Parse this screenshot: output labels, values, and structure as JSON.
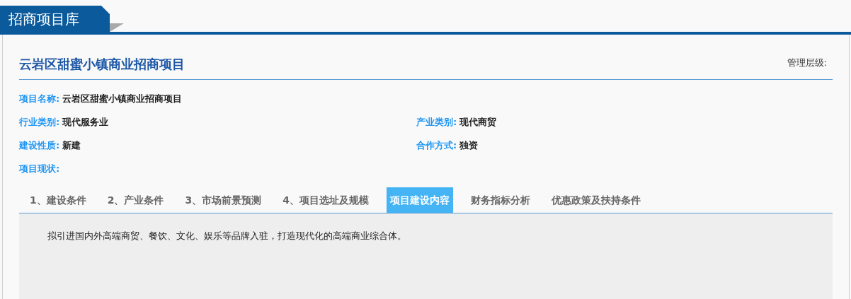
{
  "header": {
    "title": "招商项目库"
  },
  "project": {
    "title": "云岩区甜蜜小镇商业招商项目",
    "management_level": "管理层级:"
  },
  "field_rows": [
    [
      {
        "label": "项目名称:",
        "value": "云岩区甜蜜小镇商业招商项目"
      }
    ],
    [
      {
        "label": "行业类别:",
        "value": "现代服务业"
      },
      {
        "label": "产业类别:",
        "value": "现代商贸"
      }
    ],
    [
      {
        "label": "建设性质:",
        "value": "新建"
      },
      {
        "label": "合作方式:",
        "value": "独资"
      }
    ],
    [
      {
        "label": "项目现状:"
      }
    ]
  ],
  "tabs": [
    {
      "label": "1、建设条件",
      "selected": false
    },
    {
      "label": "2、产业条件",
      "selected": false
    },
    {
      "label": "3、市场前景预测",
      "selected": false
    },
    {
      "label": "4、项目选址及规模",
      "selected": false
    },
    {
      "label": "项目建设内容",
      "selected": true
    },
    {
      "label": "财务指标分析",
      "selected": false
    },
    {
      "label": "优惠政策及扶持条件",
      "selected": false
    }
  ],
  "content": "拟引进国内外高端商贸、餐饮、文化、娱乐等品牌入驻，打造现代化的高端商业综合体。"
}
